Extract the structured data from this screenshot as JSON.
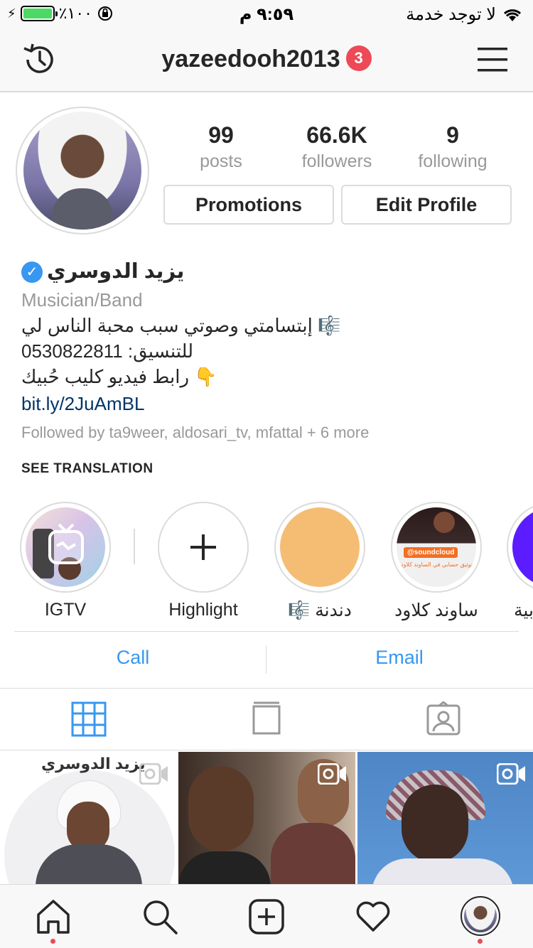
{
  "status_bar": {
    "battery": "٪١٠٠",
    "time": "٩:٥٩ م",
    "carrier": "لا توجد خدمة"
  },
  "header": {
    "username": "yazeedooh2013",
    "notification_count": "3"
  },
  "profile": {
    "posts_count": "99",
    "posts_label": "posts",
    "followers_count": "66.6K",
    "followers_label": "followers",
    "following_count": "9",
    "following_label": "following",
    "promotions_label": "Promotions",
    "edit_profile_label": "Edit Profile"
  },
  "bio": {
    "name": "يزيد الدوسري",
    "category": "Musician/Band",
    "line1": "إبتسامتي وصوتي سبب محبة الناس لي 🎼",
    "line2": "للتنسيق: 0530822811",
    "line3": "رابط فيديو كليب حُبيك 👇",
    "link": "bit.ly/2JuAmBL",
    "followed_by": "Followed by ta9weer, aldosari_tv, mfattal + 6 more",
    "see_translation": "SEE TRANSLATION"
  },
  "highlights": [
    {
      "label": "IGTV"
    },
    {
      "label": "Highlight"
    },
    {
      "label": "دندنة 🎼"
    },
    {
      "label": "ساوند كلاود"
    },
    {
      "label": "بية"
    }
  ],
  "highlight_texts": {
    "soundcloud_tag": "@soundcloud",
    "soundcloud_caption": "تم توثيق حسابي في الساوند كلاود"
  },
  "contact": {
    "call_label": "Call",
    "email_label": "Email"
  },
  "grid": {
    "post1_overlay": "يزيد الدوسري"
  },
  "colors": {
    "accent_blue": "#3897f0",
    "badge_red": "#ed4956",
    "highlight_orange": "#f5bd74",
    "highlight_purple": "#5b1cff"
  }
}
